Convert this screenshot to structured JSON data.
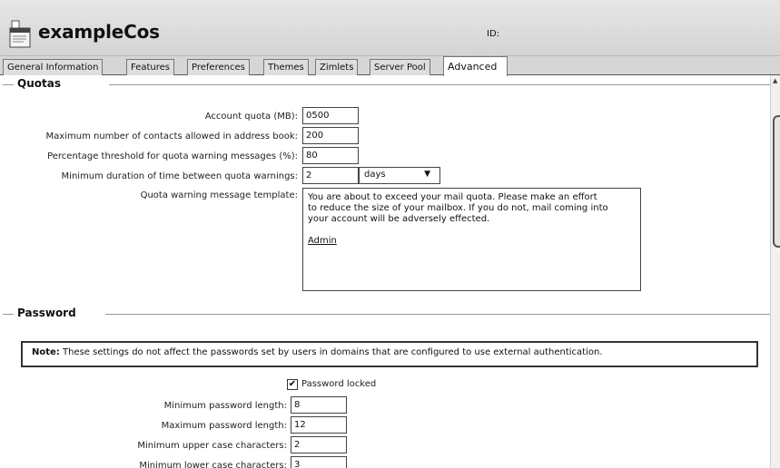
{
  "header": {
    "cos_name": "exampleCos",
    "id_label": "ID:"
  },
  "tabs": [
    {
      "label": "General Information",
      "active": false
    },
    {
      "label": "Features",
      "active": false
    },
    {
      "label": "Preferences",
      "active": false
    },
    {
      "label": "Themes",
      "active": false
    },
    {
      "label": "Zimlets",
      "active": false
    },
    {
      "label": "Server Pool",
      "active": false
    },
    {
      "label": "Advanced",
      "active": true
    }
  ],
  "quotas": {
    "title": "Quotas",
    "account_quota_label": "Account quota (MB):",
    "account_quota_value": "0500",
    "max_contacts_label": "Maximum number of contacts allowed in address book:",
    "max_contacts_value": "200",
    "warn_pct_label": "Percentage threshold for quota warning messages (%):",
    "warn_pct_value": "80",
    "min_duration_label": "Minimum duration of time between quota warnings:",
    "min_duration_value": "2",
    "min_duration_unit": "days",
    "template_label": "Quota warning message template:",
    "template_lines": [
      "You are about to exceed your mail quota. Please make an effort",
      "to reduce the size of your mailbox. If you do not, mail coming into",
      "your account will be adversely effected."
    ],
    "template_signature": "Admin"
  },
  "password": {
    "title": "Password",
    "note_prefix": "Note:",
    "note_text": " These settings do not affect the passwords set by users in domains that are configured to use external authentication.",
    "locked_label": "Password locked",
    "locked_checked": true,
    "min_len_label": "Minimum password length:",
    "min_len_value": "8",
    "max_len_label": "Maximum password length:",
    "max_len_value": "12",
    "min_upper_label": "Minimum upper case characters:",
    "min_upper_value": "2",
    "min_lower_label": "Minimum lower case characters:",
    "min_lower_value": "3"
  },
  "icons": {
    "cos": "cos-document-icon",
    "dropdown": "chevron-down-icon",
    "check": "checkmark-icon"
  },
  "colors": {
    "header_bg": "#d9d9d9",
    "tab_bg": "#dedede",
    "active_tab_bg": "#ffffff"
  }
}
